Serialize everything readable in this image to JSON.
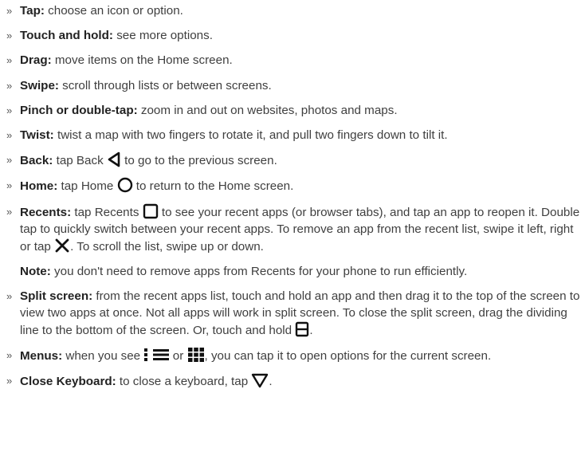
{
  "bullet": "»",
  "items": [
    {
      "term": "Tap:",
      "text": " choose an icon or option."
    },
    {
      "term": "Touch and hold:",
      "text": " see more options."
    },
    {
      "term": "Drag:",
      "text": " move items on the Home screen."
    },
    {
      "term": "Swipe:",
      "text": " scroll through lists or between screens."
    },
    {
      "term": "Pinch or double-tap:",
      "text": " zoom in and out on websites, photos and maps."
    },
    {
      "term": "Twist:",
      "text": " twist a map with two fingers to rotate it, and pull two fingers down to tilt it."
    }
  ],
  "back": {
    "term": "Back:",
    "pre": " tap Back ",
    "post": " to go to the previous screen.",
    "icon": "back-triangle-icon"
  },
  "home": {
    "term": "Home:",
    "pre": " tap Home ",
    "post": " to return to the Home screen.",
    "icon": "home-circle-icon"
  },
  "recents": {
    "term": "Recents:",
    "pre": " tap Recents ",
    "mid": " to see your recent apps (or browser tabs), and tap an app to reopen it. Double tap to quickly switch between your recent apps. To remove an app from the recent list, swipe it left, right or tap ",
    "post": ". To scroll the list, swipe up or down.",
    "icons": [
      "recents-square-icon",
      "close-x-icon"
    ]
  },
  "note": {
    "term": "Note:",
    "text": " you don't need to remove apps from Recents for your phone to run efficiently."
  },
  "split": {
    "term": "Split screen:",
    "text": " from the recent apps list, touch and hold an app and then drag it to the top of the screen to view two apps at once. Not all apps will work in split screen. To close the split screen, drag the dividing line to the bottom of the screen. Or, touch and hold ",
    "post": ".",
    "icon": "split-screen-icon"
  },
  "menus": {
    "term": "Menus:",
    "pre": " when you see ",
    "sep1": " ",
    "sep2": " or ",
    "post": ", you can tap it to open options for the current screen.",
    "icons": [
      "vertical-dots-menu-icon",
      "hamburger-menu-icon",
      "grid-menu-icon"
    ]
  },
  "keyboard": {
    "term": "Close Keyboard:",
    "pre": " to close a keyboard, tap ",
    "post": ".",
    "icon": "keyboard-close-icon"
  }
}
